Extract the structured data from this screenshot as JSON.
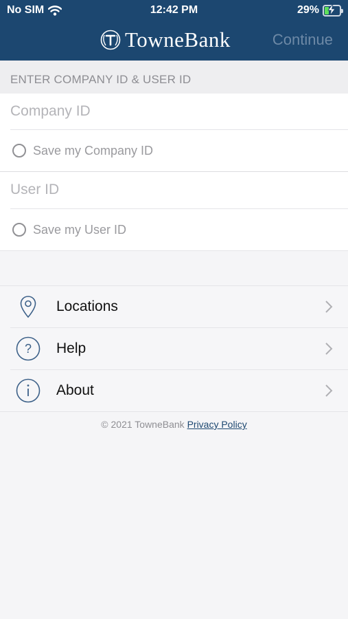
{
  "status_bar": {
    "carrier": "No SIM",
    "time": "12:42 PM",
    "battery_percent": "29%",
    "battery_level": 0.29,
    "charging": true
  },
  "header": {
    "brand_name": "TowneBank",
    "continue_label": "Continue"
  },
  "form": {
    "section_title": "ENTER COMPANY ID & USER ID",
    "company_id_placeholder": "Company ID",
    "save_company_label": "Save my Company ID",
    "user_id_placeholder": "User ID",
    "save_user_label": "Save my User ID"
  },
  "menu": {
    "items": [
      {
        "label": "Locations",
        "icon": "location-pin-icon"
      },
      {
        "label": "Help",
        "icon": "question-circle-icon"
      },
      {
        "label": "About",
        "icon": "info-circle-icon"
      }
    ]
  },
  "footer": {
    "copyright": "© 2021 TowneBank",
    "privacy_label": "Privacy Policy"
  },
  "colors": {
    "header_bg": "#1c4770",
    "accent": "#1c4770",
    "icon_stroke": "#3c6088",
    "continue_disabled": "#6d89a6"
  }
}
